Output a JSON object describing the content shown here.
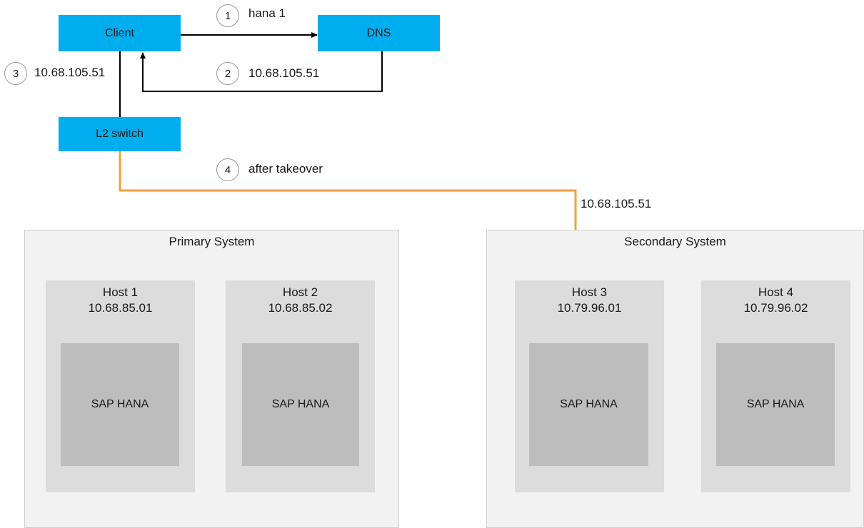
{
  "nodes": {
    "client": "Client",
    "dns": "DNS",
    "switch": "L2 switch"
  },
  "steps": [
    {
      "number": "1",
      "label": "hana 1"
    },
    {
      "number": "2",
      "label": "10.68.105.51"
    },
    {
      "number": "3",
      "label": "10.68.105.51"
    },
    {
      "number": "4",
      "label": "after takeover"
    }
  ],
  "virtual_ip_label": "10.68.105.51",
  "systems": {
    "primary": {
      "title": "Primary System",
      "hosts": [
        {
          "name": "Host 1",
          "ip": "10.68.85.01",
          "db": "SAP HANA"
        },
        {
          "name": "Host 2",
          "ip": "10.68.85.02",
          "db": "SAP HANA"
        }
      ]
    },
    "secondary": {
      "title": "Secondary System",
      "hosts": [
        {
          "name": "Host 3",
          "ip": "10.79.96.01",
          "db": "SAP HANA"
        },
        {
          "name": "Host 4",
          "ip": "10.79.96.02",
          "db": "SAP HANA"
        }
      ]
    }
  },
  "colors": {
    "node_fill": "#00aeef",
    "takeover_line": "#f0a040",
    "system_fill": "#f2f2f2",
    "host_fill": "#dcdcdc",
    "db_fill": "#bdbdbd"
  }
}
